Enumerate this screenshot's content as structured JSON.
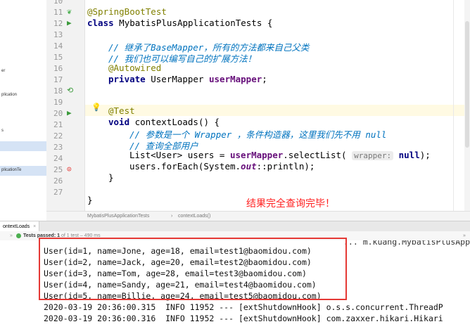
{
  "tree": {
    "fragments": [
      "er",
      "plication",
      "s",
      "plicationTe"
    ]
  },
  "editor": {
    "line_numbers": [
      "10",
      "11",
      "12",
      "13",
      "14",
      "15",
      "16",
      "17",
      "18",
      "19",
      "20",
      "21",
      "22",
      "23",
      "24",
      "25",
      "26",
      "27"
    ],
    "lines": {
      "l11_ann": "@SpringBootTest",
      "l12_kw": "class",
      "l12_rest": " MybatisPlusApplicationTests {",
      "l14_comment": "// 继承了BaseMapper，所有的方法都来自己父类",
      "l15_comment": "// 我们也可以编写自己的扩展方法！",
      "l16_ann": "@Autowired",
      "l17_kw": "private",
      "l17_type": " UserMapper ",
      "l17_field": "userMapper",
      "l17_end": ";",
      "l19_ann": "@Test",
      "l20_kw": "void",
      "l20_rest": " contextLoads() {",
      "l21_comment": "// 参数是一个 Wrapper ，条件构造器，这里我们先不用 null",
      "l22_comment": "// 查询全部用户",
      "l23_a": "List<User> users = ",
      "l23_field": "userMapper",
      "l23_b": ".selectList( ",
      "l23_hint": "wrapper:",
      "l23_null": " null",
      "l23_c": ");",
      "l24_a": "users.forEach(System.",
      "l24_out": "out",
      "l24_b": "::println);",
      "l25": "}",
      "l27": "}"
    },
    "annotation_msg": "结果完全查询完毕！"
  },
  "breadcrumb": {
    "class_name": "MybatisPlusApplicationTests",
    "separator": "›",
    "method": "contextLoads()"
  },
  "run": {
    "tab_label": "ontextLoads",
    "tab_close": "×",
    "status_prefix": "Tests passed:",
    "status_count": "1",
    "status_rest": "of 1 test – 490 ms",
    "expand_chevron": "»"
  },
  "console": {
    "top_partial": "... m.kuang.MybatisPlusApp",
    "users": [
      "User(id=1, name=Jone, age=18, email=test1@baomidou.com)",
      "User(id=2, name=Jack, age=20, email=test2@baomidou.com)",
      "User(id=3, name=Tom, age=28, email=test3@baomidou.com)",
      "User(id=4, name=Sandy, age=21, email=test4@baomidou.com)",
      "User(id=5, name=Billie, age=24, email=test5@baomidou.com)"
    ],
    "logs": [
      "2020-03-19 20:36:00.315  INFO 11952 --- [extShutdownHook] o.s.s.concurrent.ThreadP",
      "2020-03-19 20:36:00.316  INFO 11952 --- [extShutdownHook] com.zaxxer.hikari.Hikari"
    ]
  },
  "colors": {
    "keyword": "#000080",
    "annotation": "#808000",
    "comment": "#0073bf",
    "field": "#660e7a",
    "highlight_box": "#e53935",
    "message": "#ff2020"
  }
}
